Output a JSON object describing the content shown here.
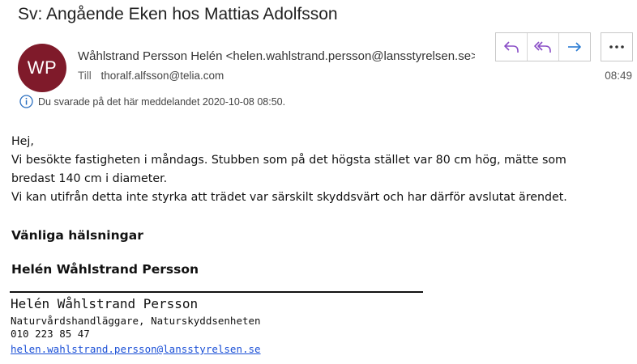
{
  "email": {
    "subject": "Sv: Angående Eken hos Mattias Adolfsson",
    "avatar_initials": "WP",
    "avatar_color": "#7f1a2a",
    "sender": "Wåhlstrand Persson Helén <helen.wahlstrand.persson@lansstyrelsen.se>",
    "to_label": "Till",
    "to_address": "thoralf.alfsson@telia.com",
    "time": "08:49",
    "info_message": "Du svarade på det här meddelandet 2020-10-08 08:50."
  },
  "actions": {
    "reply_icon": "reply-icon",
    "reply_all_icon": "reply-all-icon",
    "forward_icon": "forward-icon",
    "more_icon": "more-icon",
    "reply_color": "#8a4fc7",
    "forward_color": "#2b7cd3"
  },
  "body": {
    "line1": "Hej,",
    "line2": "Vi besökte fastigheten i måndags. Stubben som på det högsta stället var 80 cm hög, mätte som",
    "line3": "bredast 140 cm i diameter.",
    "line4": "Vi kan utifrån detta inte styrka att trädet var särskilt skyddsvärt och har därför avslutat ärendet.",
    "greeting": "Vänliga hälsningar",
    "signature_name_bold": "Helén Wåhlstrand Persson"
  },
  "signature": {
    "name": "Helén Wåhlstrand Persson",
    "title": "Naturvårdshandläggare, Naturskyddsenheten",
    "phone": "010 223 85 47",
    "email": "helen.wahlstrand.persson@lansstyrelsen.se",
    "link_color": "#1a4fd6"
  }
}
